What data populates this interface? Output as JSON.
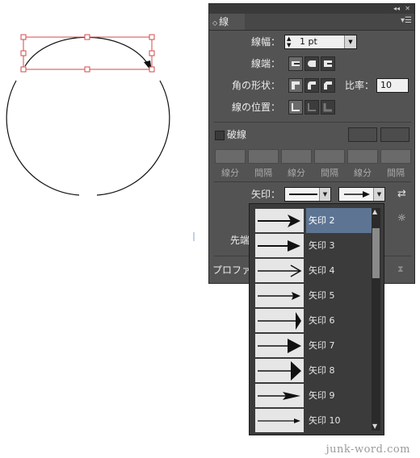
{
  "panel": {
    "tab_title": "線",
    "weight_label": "線幅：",
    "weight_value": "1 pt",
    "cap_label": "線端：",
    "corner_label": "角の形状：",
    "miter_label": "比率：",
    "miter_value": "10",
    "align_label": "線の位置：",
    "dashed_label": "破線",
    "dash_labels": [
      "線分",
      "間隔",
      "線分",
      "間隔",
      "線分",
      "間隔"
    ],
    "arrowheads_label": "矢印：",
    "tip_label": "先端",
    "profile_label": "プロファ"
  },
  "arrow_list": [
    {
      "label": "矢印 2",
      "selected": true
    },
    {
      "label": "矢印 3",
      "selected": false
    },
    {
      "label": "矢印 4",
      "selected": false
    },
    {
      "label": "矢印 5",
      "selected": false
    },
    {
      "label": "矢印 6",
      "selected": false
    },
    {
      "label": "矢印 7",
      "selected": false
    },
    {
      "label": "矢印 8",
      "selected": false
    },
    {
      "label": "矢印 9",
      "selected": false
    },
    {
      "label": "矢印 10",
      "selected": false
    }
  ],
  "watermark": "junk-word.com",
  "colors": {
    "panel": "#535353",
    "selection": "#5d7593",
    "path_selection": "#cc2222"
  }
}
